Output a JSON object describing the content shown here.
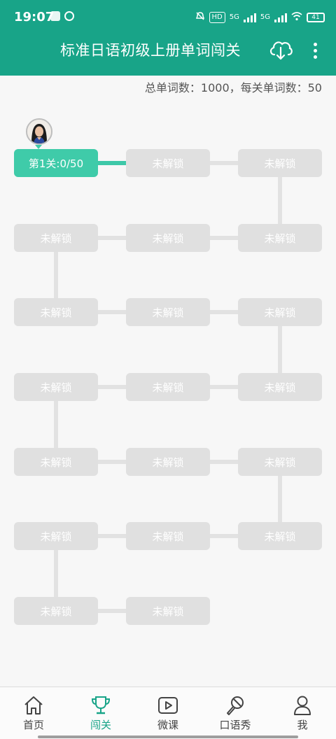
{
  "status_bar": {
    "time": "19:07",
    "hd_label": "HD",
    "net1": "5G",
    "net2": "5G",
    "battery": "41"
  },
  "header": {
    "title": "标准日语初级上册单词闯关",
    "cloud_icon": "cloud-download-icon",
    "more_icon": "more-vertical-icon"
  },
  "summary": {
    "text": "总单词数：1000，每关单词数：50"
  },
  "levels": [
    {
      "label": "第1关:0/50",
      "unlocked": true
    },
    {
      "label": "未解锁",
      "unlocked": false
    },
    {
      "label": "未解锁",
      "unlocked": false
    },
    {
      "label": "未解锁",
      "unlocked": false
    },
    {
      "label": "未解锁",
      "unlocked": false
    },
    {
      "label": "未解锁",
      "unlocked": false
    },
    {
      "label": "未解锁",
      "unlocked": false
    },
    {
      "label": "未解锁",
      "unlocked": false
    },
    {
      "label": "未解锁",
      "unlocked": false
    },
    {
      "label": "未解锁",
      "unlocked": false
    },
    {
      "label": "未解锁",
      "unlocked": false
    },
    {
      "label": "未解锁",
      "unlocked": false
    },
    {
      "label": "未解锁",
      "unlocked": false
    },
    {
      "label": "未解锁",
      "unlocked": false
    },
    {
      "label": "未解锁",
      "unlocked": false
    },
    {
      "label": "未解锁",
      "unlocked": false
    },
    {
      "label": "未解锁",
      "unlocked": false
    },
    {
      "label": "未解锁",
      "unlocked": false
    },
    {
      "label": "未解锁",
      "unlocked": false
    },
    {
      "label": "未解锁",
      "unlocked": false
    }
  ],
  "bottom_nav": [
    {
      "label": "首页",
      "icon": "home-icon",
      "active": false
    },
    {
      "label": "闯关",
      "icon": "trophy-icon",
      "active": true
    },
    {
      "label": "微课",
      "icon": "play-icon",
      "active": false
    },
    {
      "label": "口语秀",
      "icon": "microphone-icon",
      "active": false
    },
    {
      "label": "我",
      "icon": "user-icon",
      "active": false
    }
  ],
  "colors": {
    "primary": "#18a488",
    "level_active": "#3fcba9",
    "level_locked": "#e0e0e0"
  }
}
